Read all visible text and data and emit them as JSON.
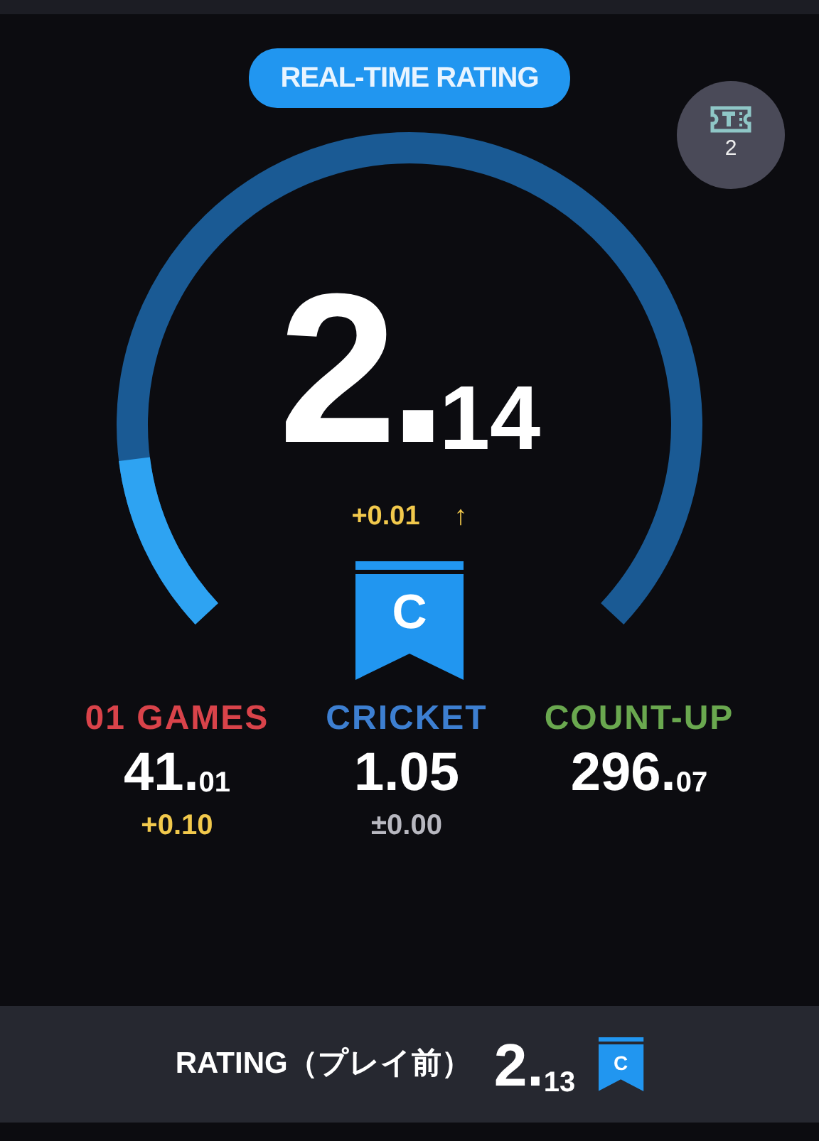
{
  "header": {
    "title": "REAL-TIME RATING",
    "ticket_count": "2"
  },
  "gauge": {
    "rating_int": "2.",
    "rating_dec": "14",
    "change": "+0.01",
    "trend_arrow": "↑",
    "rank": "C"
  },
  "stats": [
    {
      "label": "01 GAMES",
      "color": "#d9434a",
      "value": "41.",
      "decimals": "01",
      "change": {
        "text": "+0.10",
        "color": "#f2c94c"
      }
    },
    {
      "label": "CRICKET",
      "color": "#3d7fd1",
      "value": "1.05",
      "change": {
        "text": "±0.00",
        "color": "#b8b8c0"
      }
    },
    {
      "label": "COUNT-UP",
      "color": "#6aa84f",
      "value": "296.",
      "decimals": "07"
    }
  ],
  "footer": {
    "label": "RATING（プレイ前）",
    "rating_int": "2.",
    "rating_dec": "13",
    "rank": "C"
  }
}
